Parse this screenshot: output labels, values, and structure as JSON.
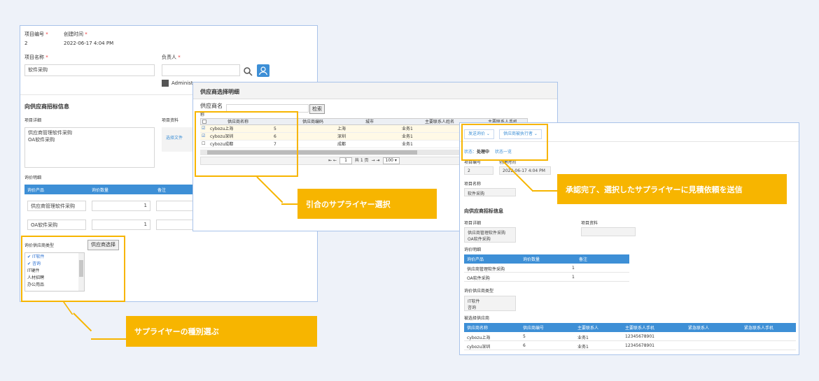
{
  "left": {
    "f_no_label": "项目编号",
    "f_no_val": "2",
    "f_time_label": "创建时间",
    "f_time_val": "2022-06-17 4:04 PM",
    "f_name_label": "项目名称",
    "f_name_val": "软件采购",
    "f_owner_label": "负责人",
    "f_owner_val": "Administ",
    "section": "向供应商招标信息",
    "detail_label": "项目详细",
    "detail_val1": "供应商管理软件采购",
    "detail_val2": "OA软件采购",
    "res_label": "项目资料",
    "res_val": "选择文件",
    "quote_label": "询价明细",
    "th1": "询价产品",
    "th2": "询价数量",
    "th3": "备注",
    "rows": [
      {
        "p": "供应商管理软件采购",
        "q": "1"
      },
      {
        "p": "OA软件采购",
        "q": "1"
      }
    ],
    "type_label": "询价供应商类型",
    "type_btn": "供应商选择",
    "types": [
      "IT软件",
      "咨询",
      "IT硬件",
      "人材招聘",
      "办公用品"
    ]
  },
  "middle": {
    "title": "供应商选择明细",
    "search_label": "供应商名",
    "search_btn": "检索",
    "cols": [
      "供应商名称",
      "供应商编码",
      "城市",
      "主要联系人姓名",
      "主要联系人手机"
    ],
    "rows": [
      {
        "name": "cybozu上海",
        "code": "5",
        "city": "上海",
        "contact": "业务1",
        "checked": true
      },
      {
        "name": "cybozu深圳",
        "code": "6",
        "city": "深圳",
        "contact": "业务1",
        "checked": true
      },
      {
        "name": "cybozu成都",
        "code": "7",
        "city": "成都",
        "contact": "业务1",
        "checked": false
      }
    ],
    "pager_text": "共 1 页",
    "page_num": "1",
    "page_size": "100"
  },
  "right": {
    "btn1": "发送询价",
    "btn2": "供应商被执行者",
    "status_label": "状态：",
    "status_val": "处理中",
    "status_link": "状态一览",
    "no_label": "项目编号",
    "no_val": "2",
    "time_label": "创建时间",
    "time_val": "2022-06-17 4:04 PM",
    "name_label": "项目名称",
    "name_val": "软件采购",
    "section": "向供应商招标信息",
    "detail_label": "项目详细",
    "detail_val1": "供应商管理软件采购",
    "detail_val2": "OA软件采购",
    "res_label": "项目资料",
    "quote_label": "询价明细",
    "th1": "询价产品",
    "th2": "询价数量",
    "th3": "备注",
    "rows": [
      {
        "p": "供应商管理软件采购",
        "q": "1"
      },
      {
        "p": "OA软件采购",
        "q": "1"
      }
    ],
    "type_label": "询价供应商类型",
    "type_val1": "IT软件",
    "type_val2": "咨询",
    "sel_label": "被选择供应商",
    "sel_cols": [
      "供应商名称",
      "供应商编号",
      "主要联系人",
      "主要联系人手机",
      "紧急联系人",
      "紧急联系人手机"
    ],
    "sel_rows": [
      {
        "name": "cybozu上海",
        "code": "5",
        "contact": "业务1",
        "phone": "12345678901"
      },
      {
        "name": "cybozu深圳",
        "code": "6",
        "contact": "业务1",
        "phone": "12345678901"
      }
    ]
  },
  "callouts": {
    "c1": "サプライヤーの種別選ぶ",
    "c2": "引合のサプライヤー選択",
    "c3": "承認完了、選択したサプライヤーに見積依頼を送信"
  },
  "colors": {
    "accent": "#f7b500",
    "header_blue": "#3d8fd6",
    "border": "#a9c3ea"
  }
}
